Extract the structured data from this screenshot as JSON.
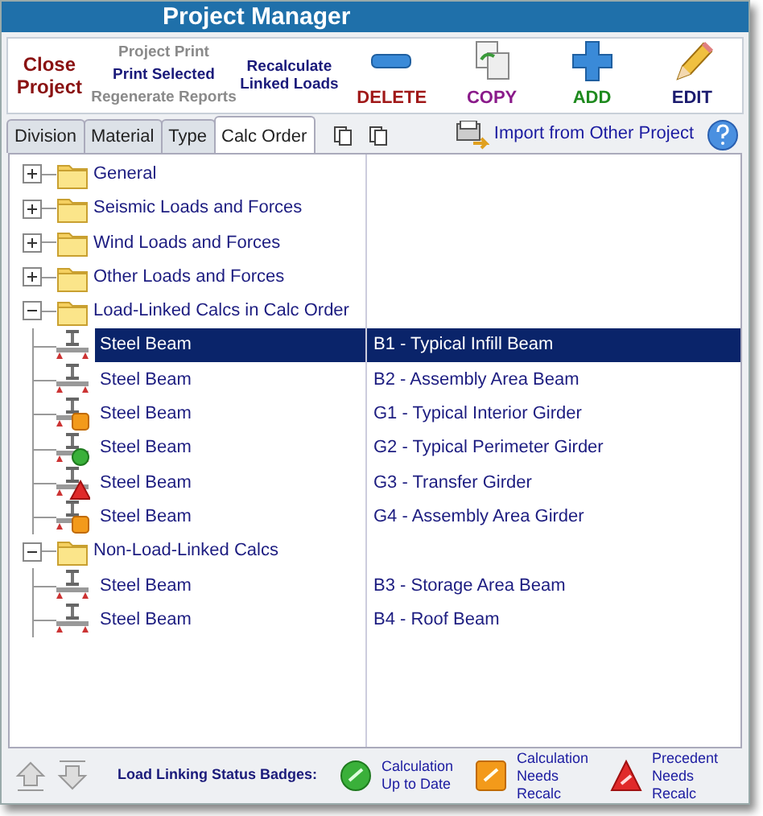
{
  "window": {
    "title": "Project Manager"
  },
  "toolbar": {
    "close": "Close Project",
    "print_menu": [
      {
        "label": "Project Print",
        "disabled": true
      },
      {
        "label": "Print Selected",
        "disabled": false
      },
      {
        "label": "Regenerate Reports",
        "disabled": true
      }
    ],
    "recalculate": "Recalculate Linked Loads",
    "actions": [
      {
        "label": "DELETE",
        "kind": "minus",
        "color": "#a01818"
      },
      {
        "label": "COPY",
        "kind": "copy",
        "color": "#8a1a8a"
      },
      {
        "label": "ADD",
        "kind": "plus",
        "color": "#1e8a1e"
      },
      {
        "label": "EDIT",
        "kind": "pencil",
        "color": "#1a1a6e"
      }
    ]
  },
  "tabs": [
    {
      "label": "Division",
      "selected": false
    },
    {
      "label": "Material",
      "selected": false
    },
    {
      "label": "Type",
      "selected": false
    },
    {
      "label": "Calc Order",
      "selected": true
    }
  ],
  "import_link": "Import from Other Project",
  "tree": [
    {
      "label": "General",
      "expanded": false
    },
    {
      "label": "Seismic Loads and Forces",
      "expanded": false
    },
    {
      "label": "Wind Loads and Forces",
      "expanded": false
    },
    {
      "label": "Other Loads and Forces",
      "expanded": false
    },
    {
      "label": "Load-Linked Calcs in Calc Order",
      "expanded": true,
      "children": [
        {
          "label": "Steel Beam",
          "description": "B1 - Typical Infill Beam",
          "selected": true,
          "kind": "plain"
        },
        {
          "label": "Steel Beam",
          "description": "B2 - Assembly Area Beam",
          "selected": false,
          "kind": "plain"
        },
        {
          "label": "Steel Beam",
          "description": "G1 - Typical Interior Girder",
          "selected": false,
          "kind": "recalc"
        },
        {
          "label": "Steel Beam",
          "description": "G2 - Typical Perimeter Girder",
          "selected": false,
          "kind": "uptodate"
        },
        {
          "label": "Steel Beam",
          "description": "G3 - Transfer Girder",
          "selected": false,
          "kind": "precedent"
        },
        {
          "label": "Steel Beam",
          "description": "G4 - Assembly Area Girder",
          "selected": false,
          "kind": "recalc"
        }
      ]
    },
    {
      "label": "Non-Load-Linked Calcs",
      "expanded": true,
      "children": [
        {
          "label": "Steel Beam",
          "description": "B3 - Storage Area Beam",
          "selected": false,
          "kind": "plain"
        },
        {
          "label": "Steel Beam",
          "description": "B4 - Roof Beam",
          "selected": false,
          "kind": "plain"
        }
      ]
    }
  ],
  "legend": {
    "title": "Load Linking Status Badges:",
    "items": [
      {
        "kind": "uptodate",
        "label": "Calculation Up to Date"
      },
      {
        "kind": "recalc",
        "label": "Calculation Needs Recalc"
      },
      {
        "kind": "precedent",
        "label": "Precedent Needs Recalc"
      }
    ]
  }
}
